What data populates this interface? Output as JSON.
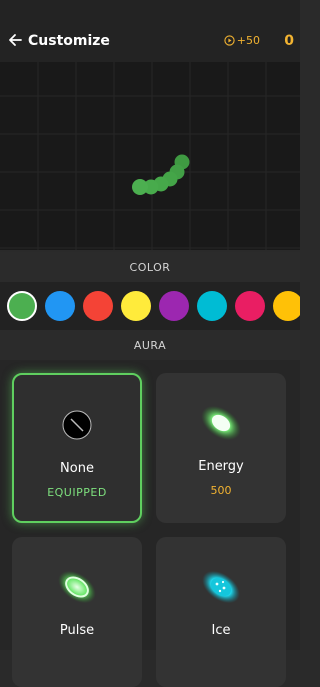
{
  "header": {
    "title": "Customize",
    "reward_label": "+50",
    "coins": "0"
  },
  "sections": {
    "color": "COLOR",
    "aura": "AURA"
  },
  "colors": [
    "#4caf50",
    "#2196f3",
    "#f44336",
    "#ffeb3b",
    "#9c27b0",
    "#00bcd4",
    "#e91e63",
    "#ffc107"
  ],
  "selected_color": "#4caf50",
  "auras": [
    {
      "name": "None",
      "status": "EQUIPPED",
      "icon": "none-icon"
    },
    {
      "name": "Energy",
      "price": "500",
      "icon": "energy-aura-icon"
    },
    {
      "name": "Pulse",
      "icon": "pulse-aura-icon"
    },
    {
      "name": "Ice",
      "icon": "ice-aura-icon"
    }
  ],
  "accent_color": "#5fcf5f",
  "price_color": "#f2b331"
}
